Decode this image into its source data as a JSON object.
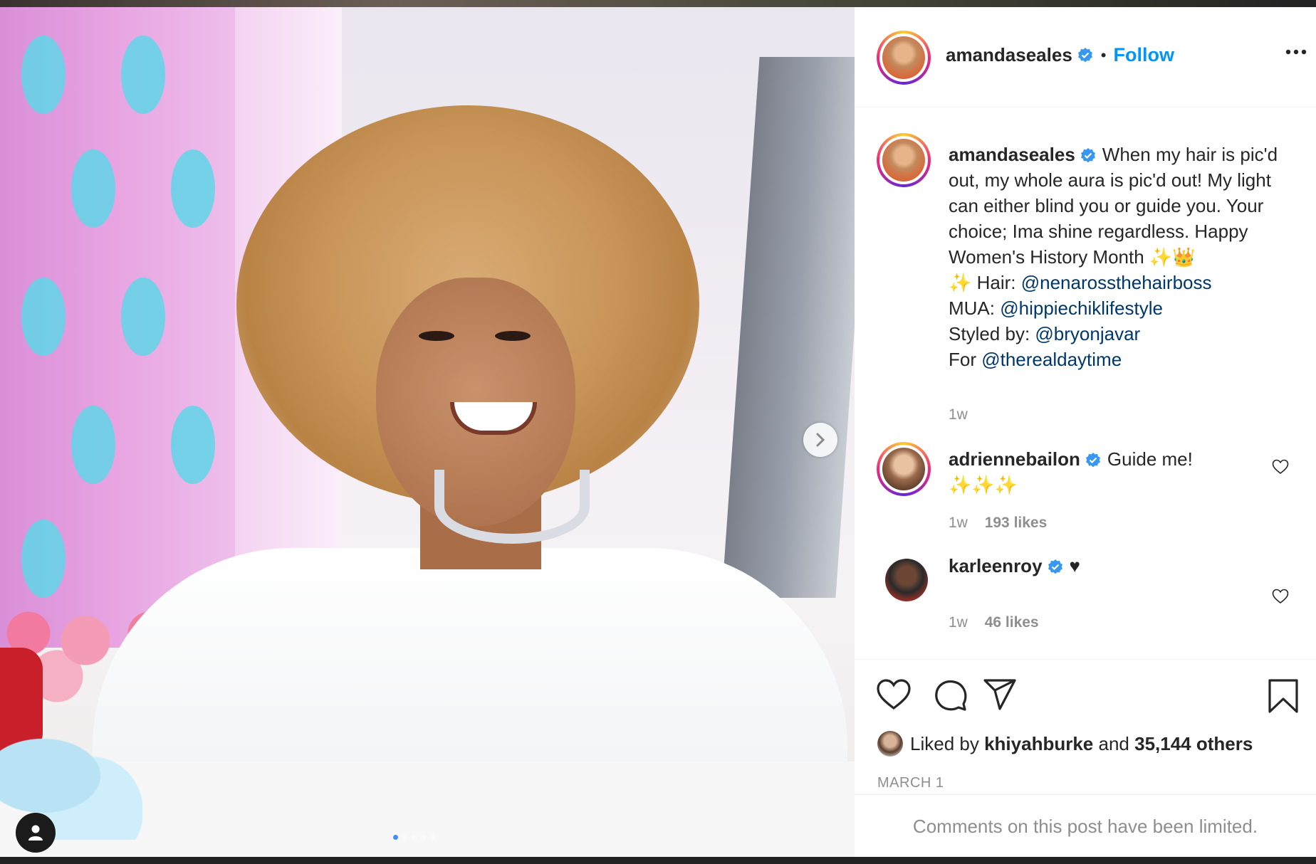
{
  "post": {
    "author": "amandaseales",
    "follow_label": "Follow",
    "separator": "•",
    "caption": {
      "text_parts": [
        "When my hair is pic'd out, my whole aura is pic'd out! My light can either blind you or guide you. Your choice; Ima shine regardless. Happy Women's History Month ✨👑",
        "✨ Hair: ",
        "MUA: ",
        "Styled by: ",
        "For "
      ],
      "mentions": [
        "@nenarossthehairboss",
        "@hippiechiklifestyle",
        "@bryonjavar",
        "@therealdaytime"
      ],
      "time": "1w"
    },
    "comments": [
      {
        "user": "adriennebailon",
        "text": "Guide me!",
        "text2": "✨✨✨",
        "time": "1w",
        "likes": "193 likes"
      },
      {
        "user": "karleenroy",
        "text": "♥",
        "time": "1w",
        "likes": "46 likes"
      }
    ],
    "liked_by": {
      "prefix": "Liked by",
      "user": "khiyahburke",
      "and": "and",
      "others": "35,144 others"
    },
    "date": "MARCH 1",
    "comments_limited": "Comments on this post have been limited.",
    "carousel": {
      "count": 5,
      "active_index": 0
    }
  },
  "colors": {
    "accent": "#0095f6",
    "verified": "#3897f0",
    "link": "#00376b",
    "muted": "#8e8e8e",
    "text": "#262626"
  },
  "icons": [
    "more-icon",
    "verified-badge-icon",
    "heart-icon",
    "comment-icon",
    "share-icon",
    "bookmark-icon",
    "chevron-right-icon",
    "user-tag-icon"
  ]
}
